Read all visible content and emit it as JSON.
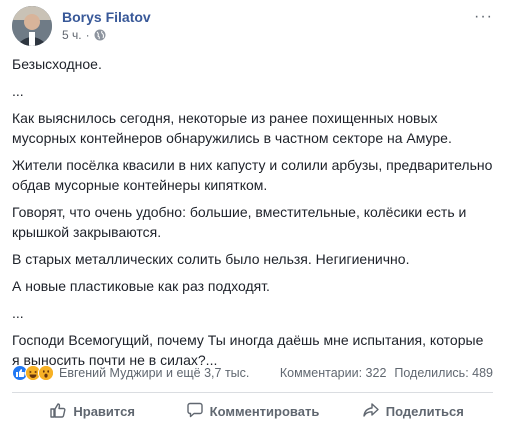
{
  "post": {
    "author": "Borys Filatov",
    "time": "5 ч.",
    "more_label": "···",
    "paragraphs": [
      "Безысходное.",
      "...",
      "Как выяснилось сегодня, некоторые из ранее похищенных новых мусорных контейнеров обнаружились в частном секторе на Амуре.",
      "Жители посёлка квасили в них капусту и солили арбузы, предварительно обдав мусорные контейнеры кипятком.",
      "Говорят, что очень удобно: большие, вместительные, колёсики есть и крышкой закрываются.",
      "В старых металлических солить было нельзя. Негигиенично.",
      "А новые пластиковые как раз подходят.",
      "...",
      "Господи Всемогущий, почему Ты иногда даёшь мне испытания, которые я выносить почти не в силах?..."
    ]
  },
  "stats": {
    "reactors": "Евгений Муджири и ещё 3,7 тыс.",
    "comments": "Комментарии: 322",
    "shares": "Поделились: 489",
    "reaction_icons": [
      "like-icon",
      "haha-icon",
      "wow-icon"
    ]
  },
  "actions": {
    "like": "Нравится",
    "comment": "Комментировать",
    "share": "Поделиться"
  },
  "colors": {
    "author": "#385898",
    "like": "#2078f4",
    "haha": "#f7b125",
    "muted": "#606770"
  }
}
